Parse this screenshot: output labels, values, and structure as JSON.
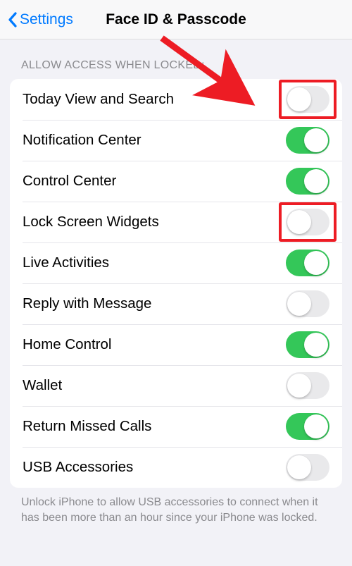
{
  "nav": {
    "back_label": "Settings",
    "title": "Face ID & Passcode"
  },
  "section": {
    "header": "ALLOW ACCESS WHEN LOCKED:",
    "items": [
      {
        "label": "Today View and Search",
        "on": false,
        "highlight": true
      },
      {
        "label": "Notification Center",
        "on": true,
        "highlight": false
      },
      {
        "label": "Control Center",
        "on": true,
        "highlight": false
      },
      {
        "label": "Lock Screen Widgets",
        "on": false,
        "highlight": true
      },
      {
        "label": "Live Activities",
        "on": true,
        "highlight": false
      },
      {
        "label": "Reply with Message",
        "on": false,
        "highlight": false
      },
      {
        "label": "Home Control",
        "on": true,
        "highlight": false
      },
      {
        "label": "Wallet",
        "on": false,
        "highlight": false
      },
      {
        "label": "Return Missed Calls",
        "on": true,
        "highlight": false
      },
      {
        "label": "USB Accessories",
        "on": false,
        "highlight": false
      }
    ],
    "footer": "Unlock iPhone to allow USB accessories to connect when it has been more than an hour since your iPhone was locked."
  },
  "annotations": {
    "arrow_color": "#ed1c24",
    "highlight_color": "#ed1c24"
  }
}
